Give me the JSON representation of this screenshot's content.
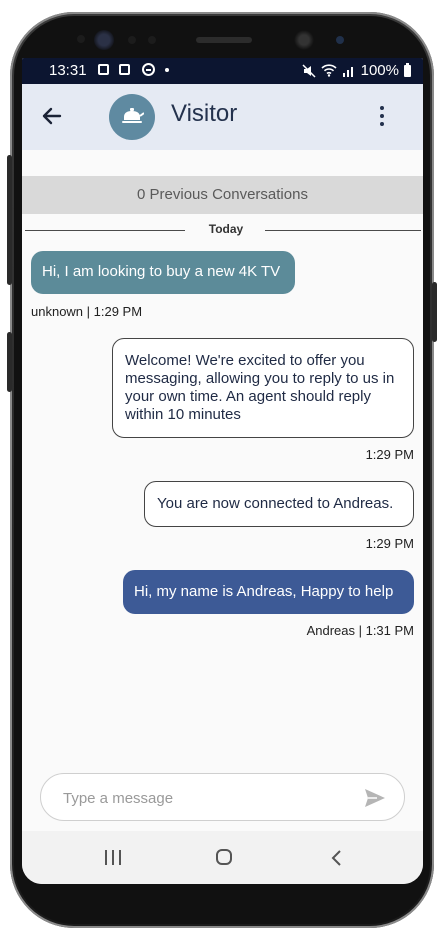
{
  "status": {
    "time": "13:31",
    "battery": "100%"
  },
  "header": {
    "title": "Visitor"
  },
  "previous_conversations": "0 Previous Conversations",
  "date_divider": "Today",
  "messages": [
    {
      "text": "Hi, I am looking to buy a new 4K TV",
      "meta": "unknown | 1:29 PM",
      "side": "left",
      "color": "#5c8b99"
    },
    {
      "text": "Welcome! We're excited to offer you messaging, allowing you to reply to us in your own time. An agent should reply within 10 minutes",
      "meta": "1:29 PM",
      "side": "right",
      "color": "#ffffff"
    },
    {
      "text": "You are now connected to Andreas.",
      "meta": "1:29 PM",
      "side": "right",
      "color": "#ffffff"
    },
    {
      "text": "Hi, my name is Andreas,  Happy to help",
      "meta": "Andreas | 1:31 PM",
      "side": "right",
      "color": "#3d5a96"
    }
  ],
  "composer": {
    "placeholder": "Type a message"
  },
  "colors": {
    "status_bar": "#0c1530",
    "app_bar": "#e5eaf3",
    "avatar": "#5f8aa1",
    "visitor_bubble": "#5c8b99",
    "agent_bubble": "#3d5a96"
  },
  "icons": [
    "back-arrow-icon",
    "kettle-icon",
    "more-vert-icon",
    "send-icon",
    "recents-icon",
    "home-icon",
    "nav-back-icon",
    "wifi-icon",
    "signal-icon",
    "battery-icon"
  ]
}
